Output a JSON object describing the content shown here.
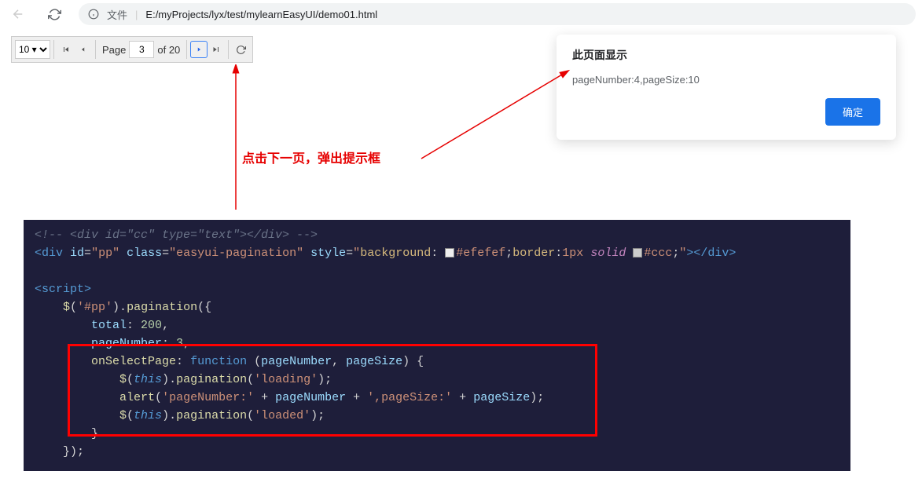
{
  "browser": {
    "file_label": "文件",
    "url": "E:/myProjects/lyx/test/mylearnEasyUI/demo01.html"
  },
  "pagination": {
    "page_size_value": "10 ▾",
    "page_label": "Page",
    "current_page": "3",
    "of_label": "of 20"
  },
  "alert": {
    "title": "此页面显示",
    "message": "pageNumber:4,pageSize:10",
    "ok": "确定"
  },
  "annotation": {
    "text": "点击下一页，弹出提示框"
  },
  "code": {
    "l0": "<!-- <div id=\"cc\" type=\"text\"></div> -->",
    "l1_a": "<",
    "l1_b": "div",
    "l1_c": " id",
    "l1_d": "=",
    "l1_e": "\"pp\"",
    "l1_f": " class",
    "l1_g": "=",
    "l1_h": "\"easyui-pagination\"",
    "l1_i": " style",
    "l1_j": "=",
    "l1_k": "\"",
    "l1_l": "background",
    "l1_m": ": ",
    "l1_n": "#efefef",
    "l1_o": ";",
    "l1_p": "border",
    "l1_q": ":",
    "l1_r": "1px",
    "l1_s": " ",
    "l1_t": "solid",
    "l1_u": " ",
    "l1_v": "#ccc",
    "l1_w": ";",
    "l1_x": "\"",
    "l1_y": "></",
    "l1_z": "div",
    "l1_end": ">",
    "l2_a": "<",
    "l2_b": "script",
    "l2_c": ">",
    "l3_a": "    $",
    "l3_b": "(",
    "l3_c": "'#pp'",
    "l3_d": ").",
    "l3_e": "pagination",
    "l3_f": "({",
    "l4_a": "        total",
    "l4_b": ": ",
    "l4_c": "200",
    "l4_d": ",",
    "l5_a": "        pageNumber",
    "l5_b": ": ",
    "l5_c": "3",
    "l5_d": ",",
    "l6_a": "        ",
    "l6_b": "onSelectPage",
    "l6_c": ": ",
    "l6_d": "function",
    "l6_e": " (",
    "l6_f": "pageNumber",
    "l6_g": ", ",
    "l6_h": "pageSize",
    "l6_i": ") {",
    "l7_a": "            $",
    "l7_b": "(",
    "l7_c": "this",
    "l7_d": ").",
    "l7_e": "pagination",
    "l7_f": "(",
    "l7_g": "'loading'",
    "l7_h": ");",
    "l8_a": "            ",
    "l8_b": "alert",
    "l8_c": "(",
    "l8_d": "'pageNumber:'",
    "l8_e": " + ",
    "l8_f": "pageNumber",
    "l8_g": " + ",
    "l8_h": "',pageSize:'",
    "l8_i": " + ",
    "l8_j": "pageSize",
    "l8_k": ");",
    "l9_a": "            $",
    "l9_b": "(",
    "l9_c": "this",
    "l9_d": ").",
    "l9_e": "pagination",
    "l9_f": "(",
    "l9_g": "'loaded'",
    "l9_h": ");",
    "l10_a": "        }",
    "l11_a": "    });"
  }
}
